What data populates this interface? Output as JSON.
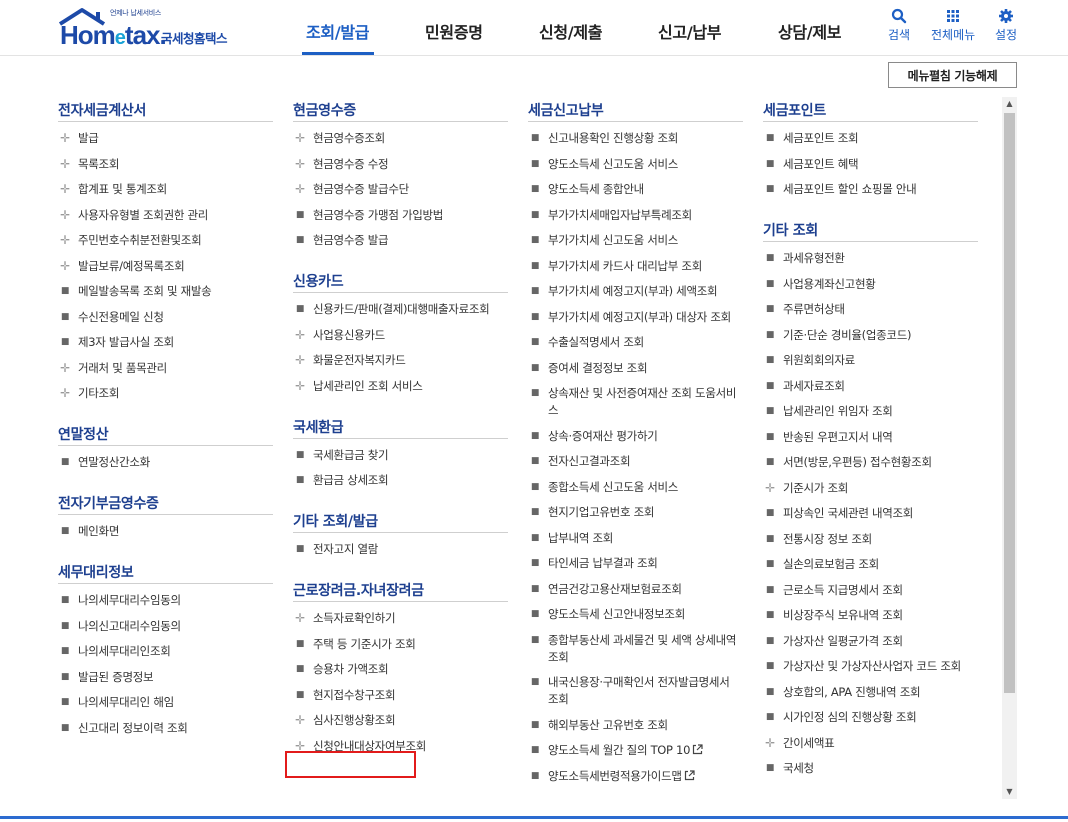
{
  "header": {
    "logo": {
      "tagline": "언제나 납세서비스",
      "brand_main": "Hom",
      "brand_e": "e",
      "brand_tail": "tax.",
      "agency": "국세청홈택스"
    },
    "nav": [
      {
        "label": "조회/발급",
        "active": true
      },
      {
        "label": "민원증명",
        "active": false
      },
      {
        "label": "신청/제출",
        "active": false
      },
      {
        "label": "신고/납부",
        "active": false
      },
      {
        "label": "상담/제보",
        "active": false
      }
    ],
    "utils": {
      "search": "검색",
      "allmenu": "전체메뉴",
      "settings": "설정"
    },
    "accent_color": "#1d5fc4"
  },
  "collapse_button": "메뉴펼침 기능해제",
  "columns": [
    {
      "sections": [
        {
          "title": "전자세금계산서",
          "items": [
            {
              "label": "발급",
              "marker": "plus"
            },
            {
              "label": "목록조회",
              "marker": "plus"
            },
            {
              "label": "합계표 및 통계조회",
              "marker": "plus"
            },
            {
              "label": "사용자유형별 조회권한 관리",
              "marker": "plus"
            },
            {
              "label": "주민번호수취분전환및조회",
              "marker": "plus"
            },
            {
              "label": "발급보류/예정목록조회",
              "marker": "plus"
            },
            {
              "label": "메일발송목록 조회 및 재발송",
              "marker": "dot"
            },
            {
              "label": "수신전용메일 신청",
              "marker": "dot"
            },
            {
              "label": "제3자 발급사실 조회",
              "marker": "dot"
            },
            {
              "label": "거래처 및 품목관리",
              "marker": "plus"
            },
            {
              "label": "기타조회",
              "marker": "plus"
            }
          ]
        },
        {
          "title": "연말정산",
          "items": [
            {
              "label": "연말정산간소화",
              "marker": "dot"
            }
          ]
        },
        {
          "title": "전자기부금영수증",
          "items": [
            {
              "label": "메인화면",
              "marker": "dot"
            }
          ]
        },
        {
          "title": "세무대리정보",
          "items": [
            {
              "label": "나의세무대리수임동의",
              "marker": "dot"
            },
            {
              "label": "나의신고대리수임동의",
              "marker": "dot"
            },
            {
              "label": "나의세무대리인조회",
              "marker": "dot"
            },
            {
              "label": "발급된 증명정보",
              "marker": "dot"
            },
            {
              "label": "나의세무대리인 해임",
              "marker": "dot"
            },
            {
              "label": "신고대리 정보이력 조회",
              "marker": "dot"
            }
          ]
        }
      ]
    },
    {
      "sections": [
        {
          "title": "현금영수증",
          "items": [
            {
              "label": "현금영수증조회",
              "marker": "plus"
            },
            {
              "label": "현금영수증 수정",
              "marker": "plus"
            },
            {
              "label": "현금영수증 발급수단",
              "marker": "plus"
            },
            {
              "label": "현금영수증 가맹점 가입방법",
              "marker": "dot"
            },
            {
              "label": "현금영수증 발급",
              "marker": "dot"
            }
          ]
        },
        {
          "title": "신용카드",
          "items": [
            {
              "label": "신용카드/판매(결제)대행매출자료조회",
              "marker": "dot"
            },
            {
              "label": "사업용신용카드",
              "marker": "plus"
            },
            {
              "label": "화물운전자복지카드",
              "marker": "plus"
            },
            {
              "label": "납세관리인 조회 서비스",
              "marker": "plus"
            }
          ]
        },
        {
          "title": "국세환급",
          "items": [
            {
              "label": "국세환급금 찾기",
              "marker": "dot"
            },
            {
              "label": "환급금 상세조회",
              "marker": "dot"
            }
          ]
        },
        {
          "title": "기타 조회/발급",
          "items": [
            {
              "label": "전자고지 열람",
              "marker": "dot"
            }
          ]
        },
        {
          "title": "근로장려금.자녀장려금",
          "items": [
            {
              "label": "소득자료확인하기",
              "marker": "plus"
            },
            {
              "label": "주택 등 기준시가 조회",
              "marker": "dot"
            },
            {
              "label": "승용차 가액조회",
              "marker": "dot"
            },
            {
              "label": "현지접수창구조회",
              "marker": "dot"
            },
            {
              "label": "심사진행상황조회",
              "marker": "plus"
            },
            {
              "label": "신청안내대상자여부조회",
              "marker": "plus"
            }
          ]
        }
      ]
    },
    {
      "sections": [
        {
          "title": "세금신고납부",
          "items": [
            {
              "label": "신고내용확인 진행상황 조회",
              "marker": "dot"
            },
            {
              "label": "양도소득세 신고도움 서비스",
              "marker": "dot"
            },
            {
              "label": "양도소득세 종합안내",
              "marker": "dot"
            },
            {
              "label": "부가가치세매입자납부특례조회",
              "marker": "dot"
            },
            {
              "label": "부가가치세 신고도움 서비스",
              "marker": "dot"
            },
            {
              "label": "부가가치세 카드사 대리납부 조회",
              "marker": "dot"
            },
            {
              "label": "부가가치세 예정고지(부과) 세액조회",
              "marker": "dot"
            },
            {
              "label": "부가가치세 예정고지(부과) 대상자 조회",
              "marker": "dot"
            },
            {
              "label": "수출실적명세서 조회",
              "marker": "dot"
            },
            {
              "label": "증여세 결정정보 조회",
              "marker": "dot"
            },
            {
              "label": "상속재산 및 사전증여재산 조회 도움서비스",
              "marker": "dot"
            },
            {
              "label": "상속·증여재산 평가하기",
              "marker": "dot"
            },
            {
              "label": "전자신고결과조회",
              "marker": "dot"
            },
            {
              "label": "종합소득세 신고도움 서비스",
              "marker": "dot"
            },
            {
              "label": "현지기업고유번호 조회",
              "marker": "dot"
            },
            {
              "label": "납부내역 조회",
              "marker": "dot"
            },
            {
              "label": "타인세금 납부결과 조회",
              "marker": "dot"
            },
            {
              "label": "연금건강고용산재보험료조회",
              "marker": "dot"
            },
            {
              "label": "양도소득세 신고안내정보조회",
              "marker": "dot"
            },
            {
              "label": "종합부동산세 과세물건 및 세액 상세내역 조회",
              "marker": "dot"
            },
            {
              "label": "내국신용장·구매확인서 전자발급명세서 조회",
              "marker": "dot"
            },
            {
              "label": "해외부동산 고유번호 조회",
              "marker": "dot"
            },
            {
              "label": "양도소득세 월간 질의 TOP 10",
              "marker": "dot",
              "external": true
            },
            {
              "label": "양도소득세번령적용가이드맵",
              "marker": "dot",
              "external": true
            }
          ]
        }
      ]
    },
    {
      "sections": [
        {
          "title": "세금포인트",
          "items": [
            {
              "label": "세금포인트 조회",
              "marker": "dot"
            },
            {
              "label": "세금포인트 혜택",
              "marker": "dot"
            },
            {
              "label": "세금포인트 할인 쇼핑몰 안내",
              "marker": "dot"
            }
          ]
        },
        {
          "title": "기타 조회",
          "items": [
            {
              "label": "과세유형전환",
              "marker": "dot"
            },
            {
              "label": "사업용계좌신고현황",
              "marker": "dot"
            },
            {
              "label": "주류면허상태",
              "marker": "dot"
            },
            {
              "label": "기준·단순 경비율(업종코드)",
              "marker": "dot"
            },
            {
              "label": "위원회회의자료",
              "marker": "dot"
            },
            {
              "label": "과세자료조회",
              "marker": "dot"
            },
            {
              "label": "납세관리인 위임자 조회",
              "marker": "dot"
            },
            {
              "label": "반송된 우편고지서 내역",
              "marker": "dot"
            },
            {
              "label": "서면(방문,우편등) 접수현황조회",
              "marker": "dot"
            },
            {
              "label": "기준시가 조회",
              "marker": "plus"
            },
            {
              "label": "피상속인 국세관련 내역조회",
              "marker": "dot"
            },
            {
              "label": "전통시장 정보 조회",
              "marker": "dot"
            },
            {
              "label": "실손의료보험금 조회",
              "marker": "dot"
            },
            {
              "label": "근로소득 지급명세서 조회",
              "marker": "dot"
            },
            {
              "label": "비상장주식 보유내역 조회",
              "marker": "dot"
            },
            {
              "label": "가상자산 일평균가격 조회",
              "marker": "dot"
            },
            {
              "label": "가상자산 및 가상자산사업자 코드 조회",
              "marker": "dot"
            },
            {
              "label": "상호합의, APA 진행내역 조회",
              "marker": "dot"
            },
            {
              "label": "시가인정 심의 진행상황 조회",
              "marker": "dot"
            },
            {
              "label": "간이세액표",
              "marker": "plus"
            },
            {
              "label": "국세청",
              "marker": "dot"
            }
          ]
        }
      ]
    }
  ]
}
